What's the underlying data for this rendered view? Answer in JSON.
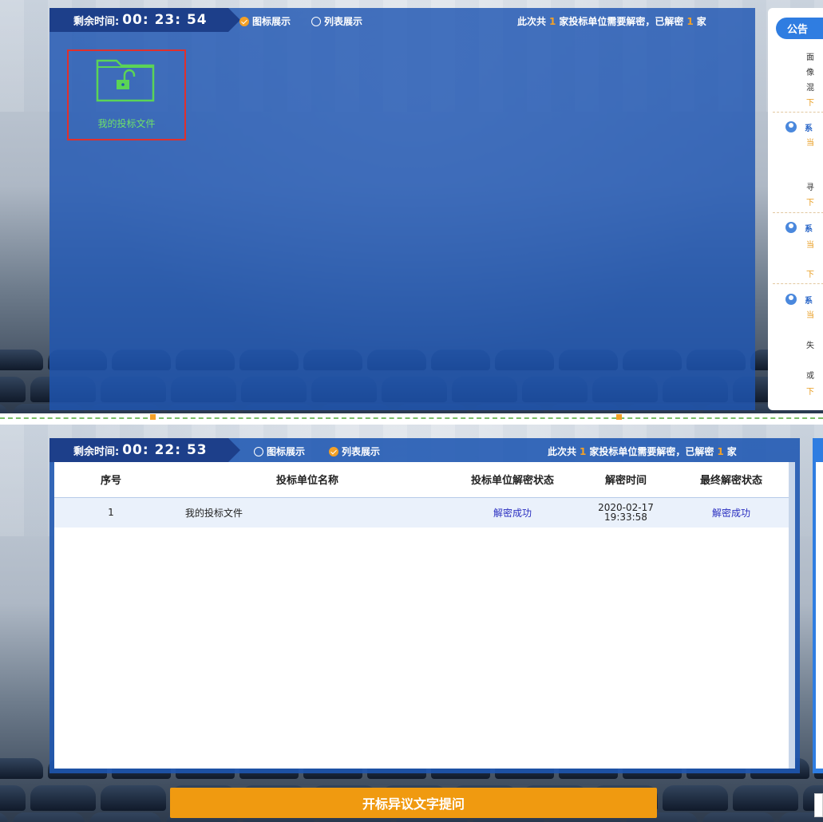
{
  "view_icon": {
    "timer": {
      "label": "剩余时间:",
      "value": "00: 23: 54"
    },
    "toggle_icon": "图标展示",
    "toggle_list": "列表展示",
    "summary": {
      "prefix": "此次共",
      "total": "1",
      "middle": "家投标单位需要解密，已解密",
      "done": "1",
      "suffix": "家"
    },
    "folder": {
      "label": "我的投标文件",
      "icon": "unlocked-folder-icon"
    },
    "announcement": {
      "tab_label": "公告",
      "entries": [
        {
          "lines": [
            "面",
            "像",
            "混"
          ],
          "next": "下"
        },
        {
          "name": "系",
          "status": "当",
          "lines": [
            "寻"
          ],
          "next": "下"
        },
        {
          "name": "系",
          "status": "当",
          "lines": [],
          "next": "下"
        },
        {
          "name": "系",
          "status": "当",
          "lines": [
            "失",
            "或"
          ],
          "next": "下"
        }
      ]
    }
  },
  "view_list": {
    "timer": {
      "label": "剩余时间:",
      "value": "00: 22: 53"
    },
    "toggle_icon": "图标展示",
    "toggle_list": "列表展示",
    "summary": {
      "prefix": "此次共",
      "total": "1",
      "middle": "家投标单位需要解密，已解密",
      "done": "1",
      "suffix": "家"
    },
    "table": {
      "headers": [
        "序号",
        "投标单位名称",
        "投标单位解密状态",
        "解密时间",
        "最终解密状态"
      ],
      "rows": [
        {
          "index": "1",
          "name": "我的投标文件",
          "decrypt_status": "解密成功",
          "time_date": "2020-02-17",
          "time_clock": "19:33:58",
          "final_status": "解密成功"
        }
      ]
    },
    "objection_button": "开标异议文字提问"
  },
  "colors": {
    "accent": "#f4a126",
    "panel_blue": "#1e56b2",
    "header_blue": "#1d3f8a",
    "success_text": "#2a2fc0",
    "folder_green": "#6ee06a",
    "highlight_red": "#e0302c"
  }
}
